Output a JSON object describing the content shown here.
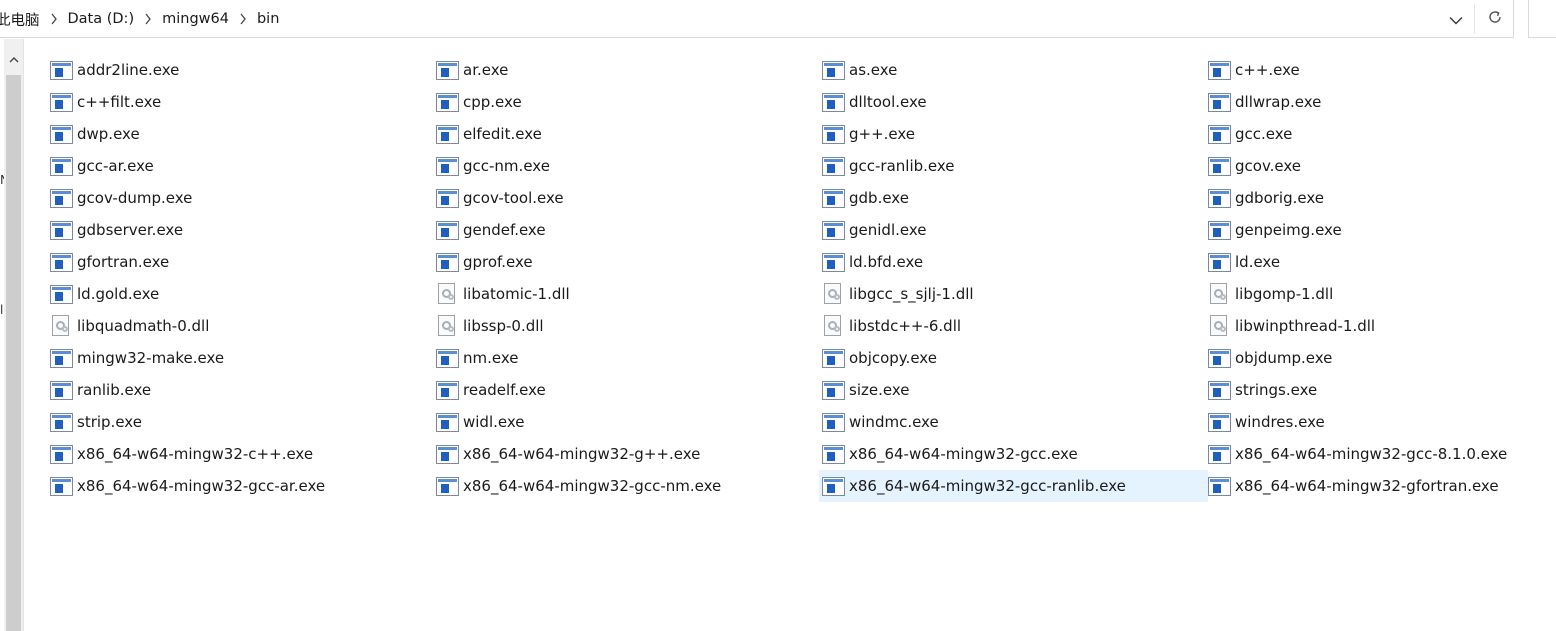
{
  "address": {
    "breadcrumbs": [
      {
        "label": "此电脑"
      },
      {
        "label": "Data (D:)"
      },
      {
        "label": "mingw64"
      },
      {
        "label": "bin"
      }
    ]
  },
  "nav_pane": {
    "glyphs": [
      "N",
      "l"
    ]
  },
  "files": [
    {
      "name": "addr2line.exe",
      "type": "exe"
    },
    {
      "name": "ar.exe",
      "type": "exe"
    },
    {
      "name": "as.exe",
      "type": "exe"
    },
    {
      "name": "c++.exe",
      "type": "exe"
    },
    {
      "name": "c++filt.exe",
      "type": "exe"
    },
    {
      "name": "cpp.exe",
      "type": "exe"
    },
    {
      "name": "dlltool.exe",
      "type": "exe"
    },
    {
      "name": "dllwrap.exe",
      "type": "exe"
    },
    {
      "name": "dwp.exe",
      "type": "exe"
    },
    {
      "name": "elfedit.exe",
      "type": "exe"
    },
    {
      "name": "g++.exe",
      "type": "exe"
    },
    {
      "name": "gcc.exe",
      "type": "exe"
    },
    {
      "name": "gcc-ar.exe",
      "type": "exe"
    },
    {
      "name": "gcc-nm.exe",
      "type": "exe"
    },
    {
      "name": "gcc-ranlib.exe",
      "type": "exe"
    },
    {
      "name": "gcov.exe",
      "type": "exe"
    },
    {
      "name": "gcov-dump.exe",
      "type": "exe"
    },
    {
      "name": "gcov-tool.exe",
      "type": "exe"
    },
    {
      "name": "gdb.exe",
      "type": "exe"
    },
    {
      "name": "gdborig.exe",
      "type": "exe"
    },
    {
      "name": "gdbserver.exe",
      "type": "exe"
    },
    {
      "name": "gendef.exe",
      "type": "exe"
    },
    {
      "name": "genidl.exe",
      "type": "exe"
    },
    {
      "name": "genpeimg.exe",
      "type": "exe"
    },
    {
      "name": "gfortran.exe",
      "type": "exe"
    },
    {
      "name": "gprof.exe",
      "type": "exe"
    },
    {
      "name": "ld.bfd.exe",
      "type": "exe"
    },
    {
      "name": "ld.exe",
      "type": "exe"
    },
    {
      "name": "ld.gold.exe",
      "type": "exe"
    },
    {
      "name": "libatomic-1.dll",
      "type": "dll"
    },
    {
      "name": "libgcc_s_sjlj-1.dll",
      "type": "dll"
    },
    {
      "name": "libgomp-1.dll",
      "type": "dll"
    },
    {
      "name": "libquadmath-0.dll",
      "type": "dll"
    },
    {
      "name": "libssp-0.dll",
      "type": "dll"
    },
    {
      "name": "libstdc++-6.dll",
      "type": "dll"
    },
    {
      "name": "libwinpthread-1.dll",
      "type": "dll"
    },
    {
      "name": "mingw32-make.exe",
      "type": "exe"
    },
    {
      "name": "nm.exe",
      "type": "exe"
    },
    {
      "name": "objcopy.exe",
      "type": "exe"
    },
    {
      "name": "objdump.exe",
      "type": "exe"
    },
    {
      "name": "ranlib.exe",
      "type": "exe"
    },
    {
      "name": "readelf.exe",
      "type": "exe"
    },
    {
      "name": "size.exe",
      "type": "exe"
    },
    {
      "name": "strings.exe",
      "type": "exe"
    },
    {
      "name": "strip.exe",
      "type": "exe"
    },
    {
      "name": "widl.exe",
      "type": "exe"
    },
    {
      "name": "windmc.exe",
      "type": "exe"
    },
    {
      "name": "windres.exe",
      "type": "exe"
    },
    {
      "name": "x86_64-w64-mingw32-c++.exe",
      "type": "exe"
    },
    {
      "name": "x86_64-w64-mingw32-g++.exe",
      "type": "exe"
    },
    {
      "name": "x86_64-w64-mingw32-gcc.exe",
      "type": "exe"
    },
    {
      "name": "x86_64-w64-mingw32-gcc-8.1.0.exe",
      "type": "exe"
    },
    {
      "name": "x86_64-w64-mingw32-gcc-ar.exe",
      "type": "exe"
    },
    {
      "name": "x86_64-w64-mingw32-gcc-nm.exe",
      "type": "exe"
    },
    {
      "name": "x86_64-w64-mingw32-gcc-ranlib.exe",
      "type": "exe",
      "selected": true
    },
    {
      "name": "x86_64-w64-mingw32-gfortran.exe",
      "type": "exe"
    }
  ],
  "colors": {
    "selection": "#e5f3ff",
    "exe_icon_accent": "#1f5fc0"
  }
}
